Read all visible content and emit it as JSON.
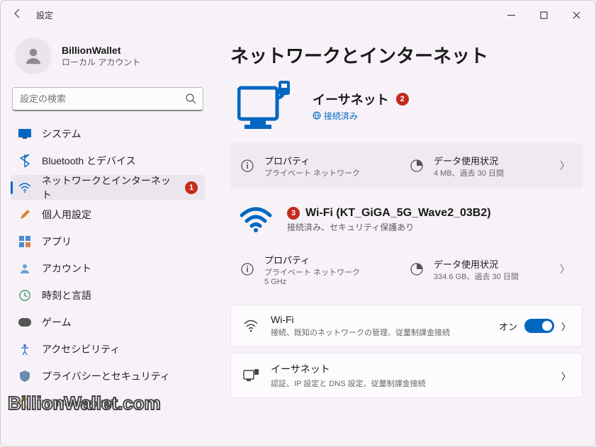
{
  "window": {
    "title": "設定"
  },
  "user": {
    "name": "BillionWallet",
    "subtitle": "ローカル アカウント"
  },
  "search": {
    "placeholder": "設定の検索"
  },
  "nav": {
    "system": "システム",
    "bluetooth": "Bluetooth とデバイス",
    "network": "ネットワークとインターネット",
    "personalization": "個人用設定",
    "apps": "アプリ",
    "accounts": "アカウント",
    "time": "時刻と言語",
    "gaming": "ゲーム",
    "accessibility": "アクセシビリティ",
    "privacy": "プライバシーとセキュリティ",
    "update": "Windows Update",
    "badge1": "1"
  },
  "page": {
    "title": "ネットワークとインターネット"
  },
  "ethernet_hero": {
    "title": "イーサネット",
    "status": "接続済み",
    "badge": "2"
  },
  "eth_props": {
    "label": "プロパティ",
    "sub": "プライベート ネットワーク",
    "data_label": "データ使用状況",
    "data_sub": "4 MB、過去 30 日間"
  },
  "wifi_hero": {
    "badge": "3",
    "title": "Wi-Fi (KT_GiGA_5G_Wave2_03B2)",
    "sub": "接続済み、セキュリティ保護あり"
  },
  "wifi_props": {
    "label": "プロパティ",
    "sub1": "プライベート ネットワーク",
    "sub2": "5 GHz",
    "data_label": "データ使用状況",
    "data_sub": "334.6 GB、過去 30 日間"
  },
  "cards": {
    "wifi": {
      "title": "Wi-Fi",
      "sub": "接続、既知のネットワークの管理、従量制課金接続",
      "toggle_label": "オン"
    },
    "ethernet": {
      "title": "イーサネット",
      "sub": "認証、IP 設定と DNS 設定、従量制課金接続"
    }
  },
  "watermark": "BillionWallet.com"
}
